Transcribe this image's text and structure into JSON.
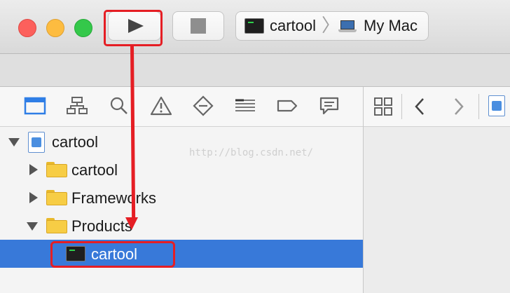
{
  "toolbar": {
    "scheme": {
      "target": "cartool",
      "destination": "My Mac"
    }
  },
  "navigator": {
    "tree": [
      {
        "label": "cartool",
        "type": "project",
        "expanded": true,
        "depth": 0
      },
      {
        "label": "cartool",
        "type": "folder",
        "expanded": false,
        "depth": 1
      },
      {
        "label": "Frameworks",
        "type": "folder",
        "expanded": false,
        "depth": 1
      },
      {
        "label": "Products",
        "type": "folder",
        "expanded": true,
        "depth": 1
      },
      {
        "label": "cartool",
        "type": "executable",
        "selected": true,
        "depth": 2
      }
    ]
  },
  "watermark": "http://blog.csdn.net/",
  "colors": {
    "selection": "#3879d9",
    "annotation": "#e51e24"
  }
}
